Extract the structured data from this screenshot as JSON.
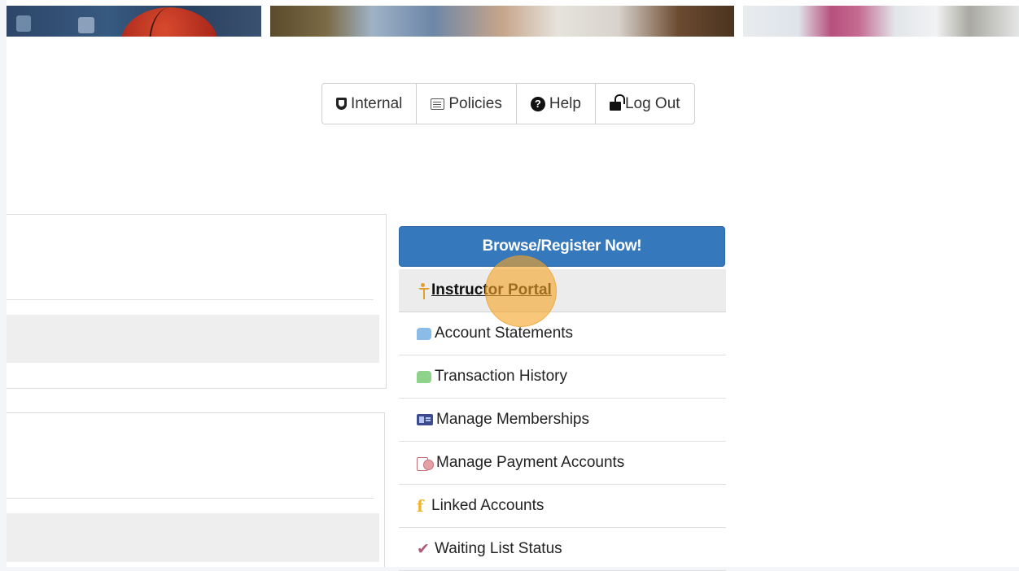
{
  "topnav": {
    "items": [
      {
        "label": "Internal",
        "icon": "shield-icon"
      },
      {
        "label": "Policies",
        "icon": "document-icon"
      },
      {
        "label": "Help",
        "icon": "help-icon"
      },
      {
        "label": "Log Out",
        "icon": "unlock-icon"
      }
    ]
  },
  "sidebar": {
    "register_label": "Browse/Register Now!",
    "register_color": "#3578bb",
    "items": [
      {
        "label": "Instructor Portal",
        "icon": "person-icon",
        "active": true
      },
      {
        "label": "Account Statements",
        "icon": "chat-bubble-icon"
      },
      {
        "label": "Transaction History",
        "icon": "chat-bubble-icon"
      },
      {
        "label": "Manage Memberships",
        "icon": "id-card-icon"
      },
      {
        "label": "Manage Payment Accounts",
        "icon": "payment-icon"
      },
      {
        "label": "Linked Accounts",
        "icon": "facebook-icon"
      },
      {
        "label": "Waiting List Status",
        "icon": "check-icon"
      }
    ]
  },
  "highlight_color": "#f5a528"
}
